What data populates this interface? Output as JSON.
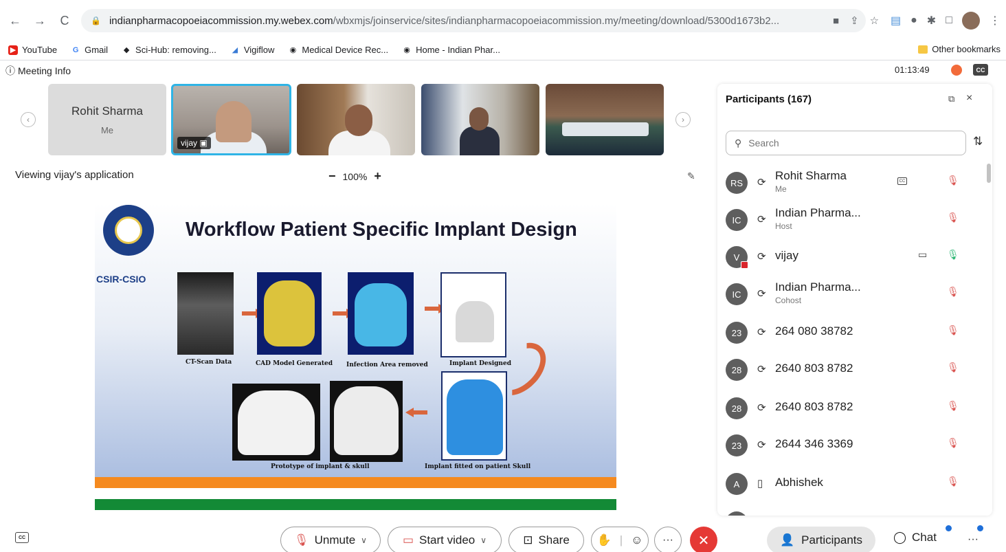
{
  "browser": {
    "url_domain": "indianpharmacopoeiacommission.my.webex.com",
    "url_path": "/wbxmjs/joinservice/sites/indianpharmacopoeiacommission.my/meeting/download/5300d1673b2...",
    "bookmarks": [
      "YouTube",
      "Gmail",
      "Sci-Hub: removing...",
      "Vigiflow",
      "Medical Device Rec...",
      "Home - Indian Phar..."
    ],
    "other_bookmarks": "Other bookmarks"
  },
  "meeting": {
    "info_label": "Meeting Info",
    "timer": "01:13:49",
    "cc_label": "CC",
    "viewing_label": "Viewing vijay's application",
    "zoom_minus": "−",
    "zoom_level": "100%",
    "zoom_plus": "+"
  },
  "video_strip": {
    "self_name": "Rohit Sharma",
    "self_tag": "Me",
    "active_speaker_tag": "vijay"
  },
  "slide": {
    "logo_text": "CSIR-CSIO",
    "title": "Workflow Patient Specific  Implant Design",
    "captions": {
      "ct": "CT-Scan Data",
      "cad": "CAD Model Generated",
      "infection": "Infection Area removed",
      "implant": "Implant Designed",
      "prototype": "Prototype of implant & skull",
      "fitted": "Implant fitted on patient Skull"
    }
  },
  "participants": {
    "title": "Participants (167)",
    "search_placeholder": "Search",
    "list": [
      {
        "initials": "RS",
        "name": "Rohit Sharma",
        "sub": "Me",
        "cc": "CC"
      },
      {
        "initials": "IC",
        "name": "Indian Pharma...",
        "sub": "Host"
      },
      {
        "initials": "V",
        "name": "vijay",
        "sub": ""
      },
      {
        "initials": "IC",
        "name": "Indian Pharma...",
        "sub": "Cohost"
      },
      {
        "initials": "23",
        "name": "264 080 38782",
        "sub": ""
      },
      {
        "initials": "28",
        "name": "2640 803 8782",
        "sub": ""
      },
      {
        "initials": "28",
        "name": "2640 803 8782",
        "sub": ""
      },
      {
        "initials": "23",
        "name": "2644 346 3369",
        "sub": ""
      },
      {
        "initials": "A",
        "name": "Abhishek",
        "sub": ""
      }
    ]
  },
  "controls": {
    "cc_label": "CC",
    "unmute": "Unmute",
    "start_video": "Start video",
    "share": "Share",
    "participants": "Participants",
    "chat": "Chat",
    "more": "···"
  }
}
